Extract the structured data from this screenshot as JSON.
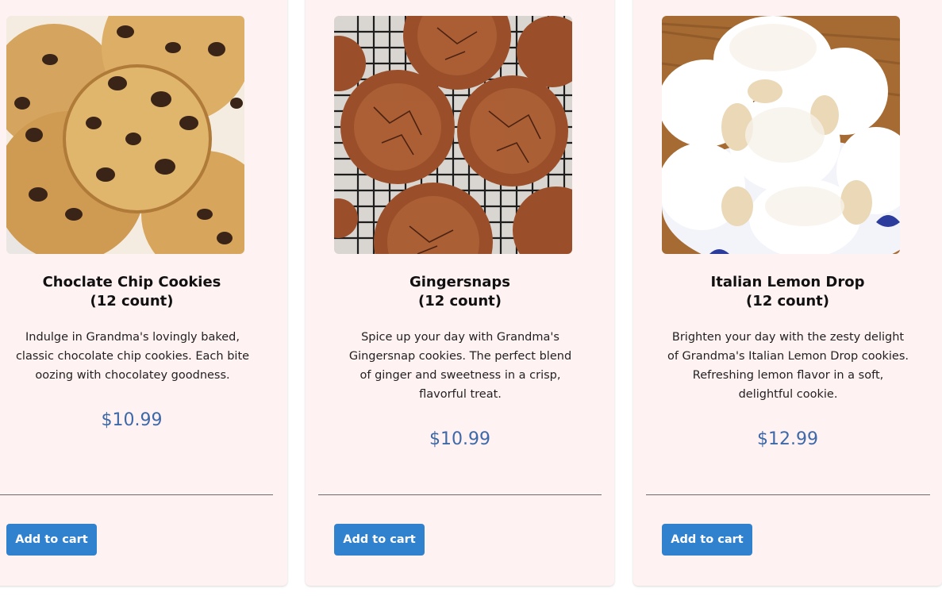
{
  "products": [
    {
      "title_line1": "Choclate Chip Cookies",
      "title_line2": "(12 count)",
      "image_alt": "chocolate chip cookies",
      "description": "Indulge in Grandma's lovingly baked, classic chocolate chip cookies. Each bite oozing with chocolatey goodness.",
      "price": "$10.99",
      "button_label": "Add to cart"
    },
    {
      "title_line1": "Gingersnaps",
      "title_line2": "(12 count)",
      "image_alt": "gingersnap cookies",
      "description": "Spice up your day with Grandma's Gingersnap cookies. The perfect blend of ginger and sweetness in a crisp, flavorful treat.",
      "price": "$10.99",
      "button_label": "Add to cart"
    },
    {
      "title_line1": "Italian Lemon Drop",
      "title_line2": "(12 count)",
      "image_alt": "italian lemon drop cookies",
      "description": "Brighten your day with the zesty delight of Grandma's Italian Lemon Drop cookies. Refreshing lemon flavor in a soft, delightful cookie.",
      "price": "$12.99",
      "button_label": "Add to cart"
    }
  ],
  "colors": {
    "card_background": "#fff2f3",
    "price": "#3d69a8",
    "button": "#3182ce",
    "button_text": "#ffffff"
  }
}
